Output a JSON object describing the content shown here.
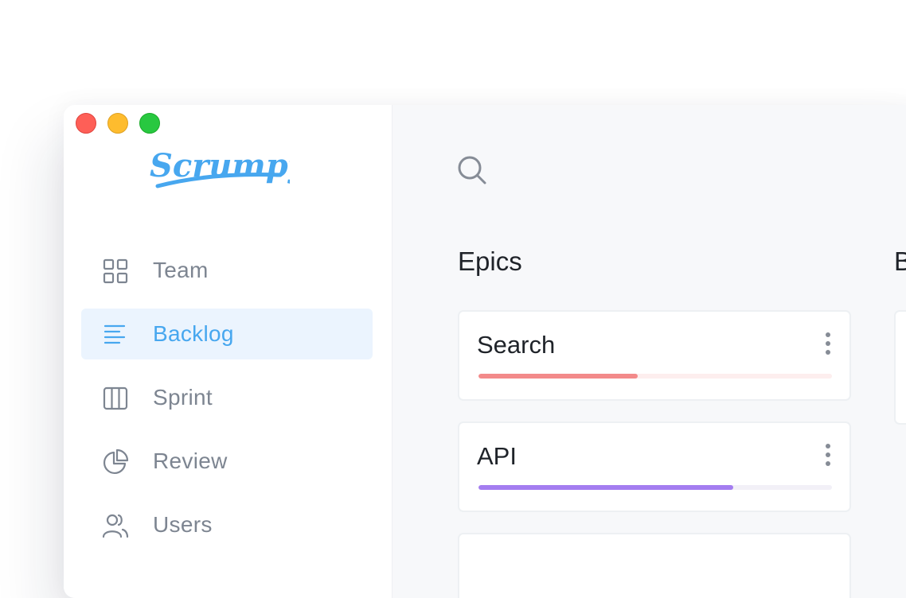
{
  "app": {
    "logo_text": "Scrumpy",
    "brand_color": "#47a7ef"
  },
  "sidebar": {
    "items": [
      {
        "label": "Team",
        "icon": "grid-icon",
        "active": false
      },
      {
        "label": "Backlog",
        "icon": "list-lines-icon",
        "active": true
      },
      {
        "label": "Sprint",
        "icon": "columns-icon",
        "active": false
      },
      {
        "label": "Review",
        "icon": "pie-chart-icon",
        "active": false
      },
      {
        "label": "Users",
        "icon": "users-icon",
        "active": false
      }
    ]
  },
  "main": {
    "search_icon": "search-icon",
    "epics": {
      "title": "Epics",
      "cards": [
        {
          "title": "Search",
          "progress": 0.45,
          "bar_color": "#f38a8a",
          "track_color": "#fdeeee"
        },
        {
          "title": "API",
          "progress": 0.72,
          "bar_color": "#a47df0",
          "track_color": "#f2f0f7"
        }
      ]
    },
    "next_column": {
      "title": "B"
    }
  }
}
